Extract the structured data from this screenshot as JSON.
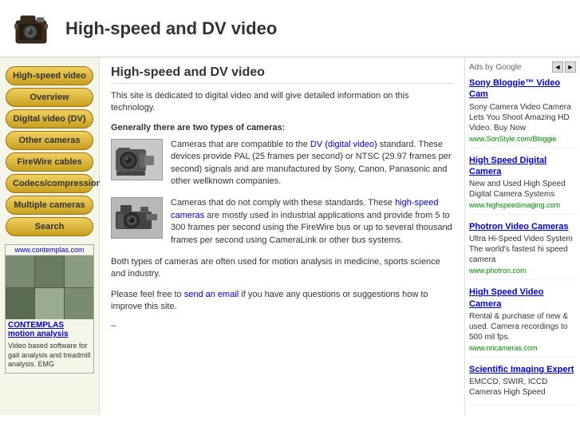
{
  "header": {
    "title": "High-speed and DV video",
    "logo_alt": "vintage camera logo"
  },
  "sidebar": {
    "nav_items": [
      {
        "label": "High-speed video",
        "id": "highspeed"
      },
      {
        "label": "Overview",
        "id": "overview"
      },
      {
        "label": "Digital video (DV)",
        "id": "dv"
      },
      {
        "label": "Other cameras",
        "id": "other"
      },
      {
        "label": "FireWire cables",
        "id": "firewire"
      },
      {
        "label": "Codecs/compression",
        "id": "codecs"
      },
      {
        "label": "Multiple cameras",
        "id": "multiple"
      },
      {
        "label": "Search",
        "id": "search"
      }
    ],
    "promo_site": "www.contemplas.com",
    "promo_title": "CONTEMPLAS motion analysis",
    "promo_desc": "Video based software for gait analysis and treadmill analysis. EMG"
  },
  "content": {
    "title": "High-speed and DV video",
    "intro": "This site is dedicated to digital video and will give detailed information on this technology.",
    "subtitle": "Generally there are two types of cameras:",
    "camera1_text": "Cameras that are compatible to the DV (digital video) standard. These devices provide PAL (25 frames per second) or NTSC (29.97 frames per second) signals and are manufactured by Sony, Canon, Panasonic and other wellknown companies.",
    "camera1_link_text": "DV (digital video)",
    "camera2_text": "Cameras that do not comply with these standards. These high-speed cameras are mostly used in industrial applications and provide from 5 to 300 frames per second using the FireWire bus or up to several thousand frames per second using CameraLink or other bus systems.",
    "camera2_link_text": "high-speed cameras",
    "paragraph1": "Both types of cameras are often used for motion analysis in medicine, sports science and industry.",
    "paragraph2": "Please feel free to send an email if you have any questions or suggestions how to improve this site.",
    "email_link_text": "send an email"
  },
  "ads": {
    "header": "Ads by Google",
    "prev_label": "◄",
    "next_label": "►",
    "items": [
      {
        "title": "Sony Bloggie™ Video Cam",
        "desc": "Sony Camera Video Camera Lets You Shoot Amazing HD Video. Buy Now",
        "url": "www.SonStyle.com/Bloggie"
      },
      {
        "title": "High Speed Digital Camera",
        "desc": "New and Used High Speed Digital Camera Systems",
        "url": "www.highspeedimaging.com"
      },
      {
        "title": "Photron Video Cameras",
        "desc": "Ultra Hi-Speed Video System The world's fastest hi speed camera",
        "url": "www.photron.com"
      },
      {
        "title": "High Speed Video Camera",
        "desc": "Rental & purchase of new & used. Camera recordings to 500 mil fps.",
        "url": "www.nricameras.com"
      },
      {
        "title": "Scientific Imaging Expert",
        "desc": "EMCCD, SWIR, ICCD Cameras High Speed",
        "url": ""
      }
    ]
  }
}
